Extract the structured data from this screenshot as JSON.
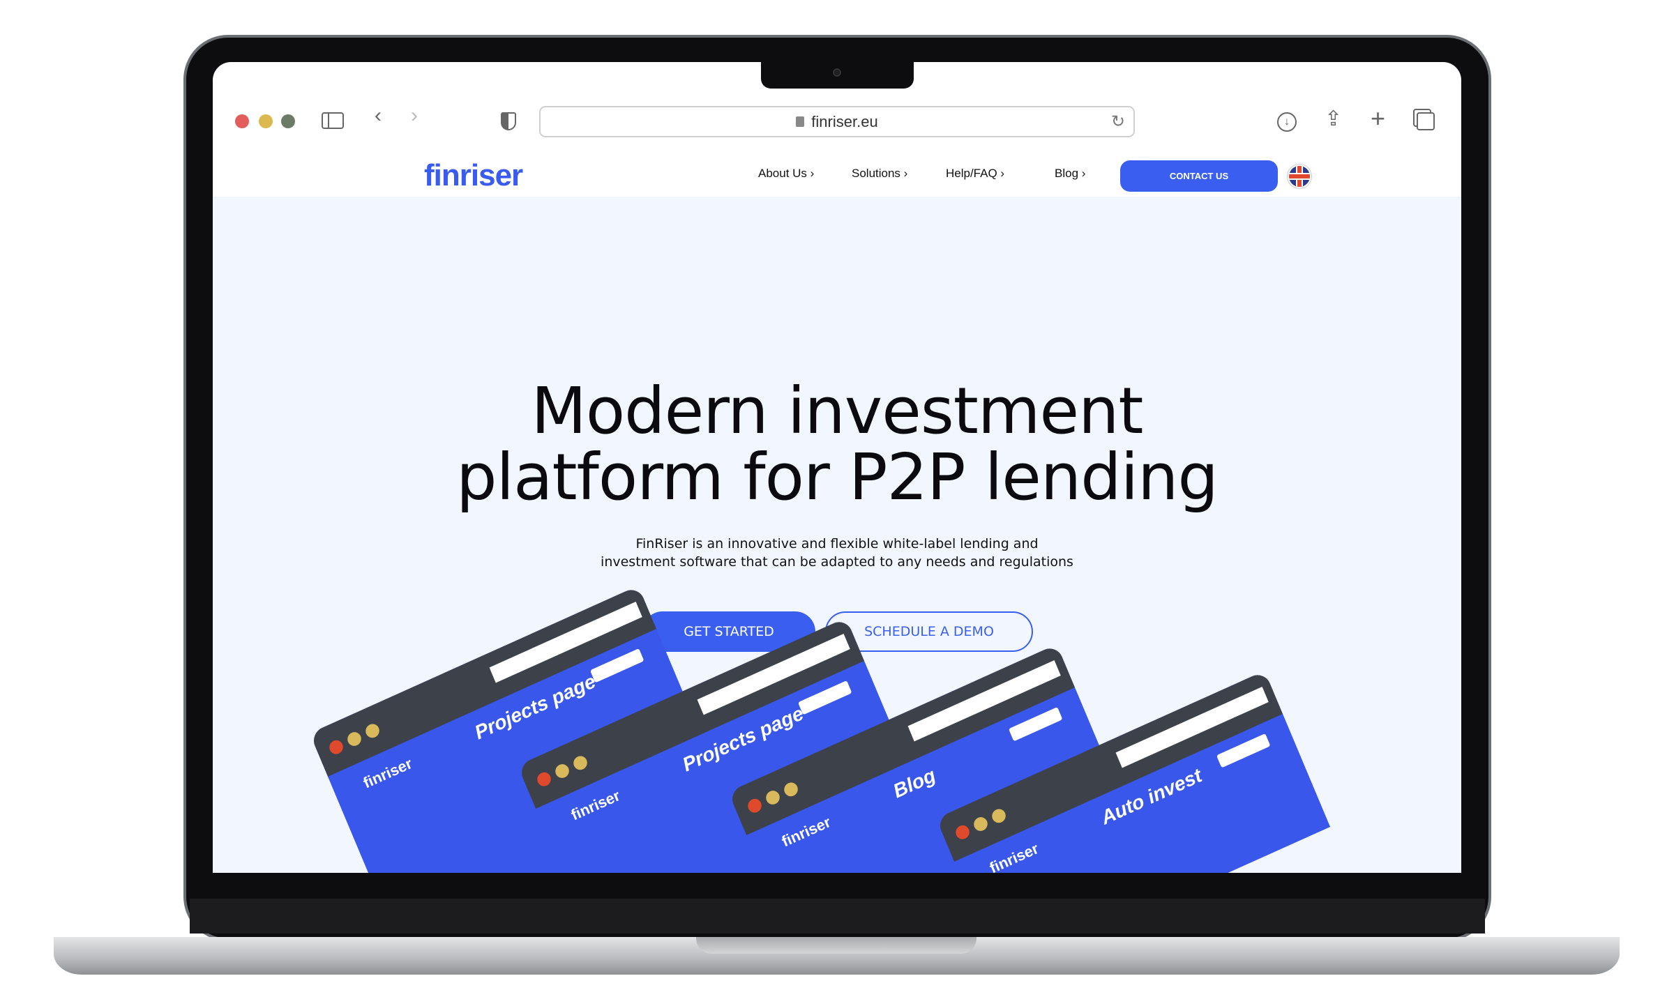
{
  "browser": {
    "url": "finriser.eu",
    "traffic_lights": [
      "#e35d5b",
      "#dcb94e",
      "#6c7a68"
    ],
    "icons": [
      "sidebar-icon",
      "back-icon",
      "forward-icon",
      "shield-icon",
      "lock-icon",
      "reload-icon",
      "download-icon",
      "share-icon",
      "new-tab-icon",
      "tabs-icon"
    ]
  },
  "site": {
    "logo": "finriser",
    "nav": [
      "About Us",
      "Solutions",
      "Help/FAQ",
      "Blog"
    ],
    "contact_label": "CONTACT US",
    "language": "uk-flag-icon",
    "accent": "#3a5ff0"
  },
  "hero": {
    "title_line1": "Modern investment",
    "title_line2": "platform for P2P lending",
    "subtitle_line1": "FinRiser is an innovative and flexible white-label lending and",
    "subtitle_line2": "investment software that can be adapted to any needs and regulations",
    "primary_button": "GET STARTED",
    "secondary_button": "SCHEDULE A DEMO"
  },
  "mockups": [
    {
      "logo": "finriser",
      "title": "Projects page"
    },
    {
      "logo": "finriser",
      "title": "Projects page"
    },
    {
      "logo": "finriser",
      "title": "Blog"
    },
    {
      "logo": "finriser",
      "title": "Auto invest"
    }
  ]
}
